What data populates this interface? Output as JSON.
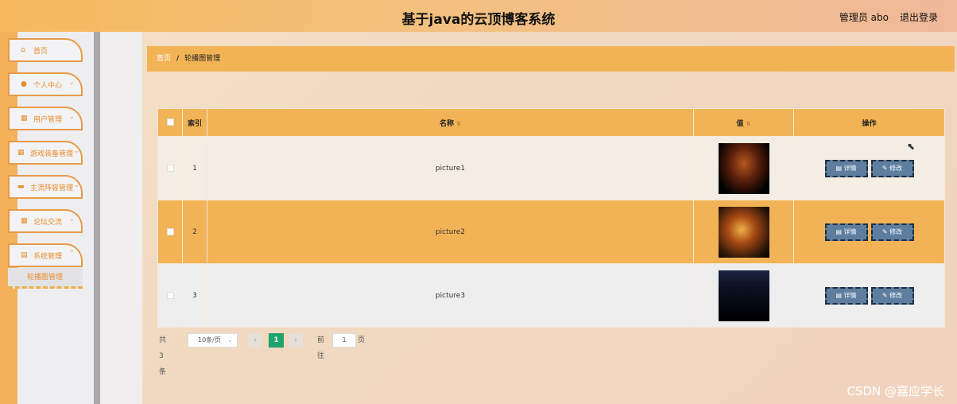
{
  "header": {
    "title": "基于java的云顶博客系统",
    "admin": "管理员 abo",
    "logout": "退出登录"
  },
  "sidebar": {
    "items": [
      {
        "label": "首页",
        "icon": "home-icon",
        "glyph": "⌂"
      },
      {
        "label": "个人中心",
        "icon": "user-icon",
        "glyph": "●"
      },
      {
        "label": "用户管理",
        "icon": "grid-icon",
        "glyph": "▦"
      },
      {
        "label": "游戏装备管理",
        "icon": "grid-icon",
        "glyph": "▦"
      },
      {
        "label": "主流阵容管理",
        "icon": "monitor-icon",
        "glyph": "▬"
      },
      {
        "label": "论坛交流",
        "icon": "grid-icon",
        "glyph": "▦"
      },
      {
        "label": "系统管理",
        "icon": "trash-icon",
        "glyph": "▤"
      }
    ],
    "submenu": "轮播图管理"
  },
  "breadcrumb": {
    "home": "首页",
    "separator": "/",
    "current": "轮播图管理"
  },
  "table": {
    "headers": {
      "index": "索引",
      "name": "名称",
      "value": "值",
      "actions": "操作"
    },
    "rows": [
      {
        "index": "1",
        "name": "picture1"
      },
      {
        "index": "2",
        "name": "picture2"
      },
      {
        "index": "3",
        "name": "picture3"
      }
    ],
    "detail_label": "详情",
    "edit_label": "修改"
  },
  "pagination": {
    "total": "共 3 条",
    "page_size": "10条/页",
    "current_page": "1",
    "goto_label": "前往",
    "goto_value": "1",
    "page_unit": "页"
  },
  "watermark": "CSDN @嘉应学长",
  "colors": {
    "accent": "#f2b356",
    "menu_border": "#e69a48",
    "button": "#5d7e9e",
    "page_active": "#1ea36a"
  }
}
